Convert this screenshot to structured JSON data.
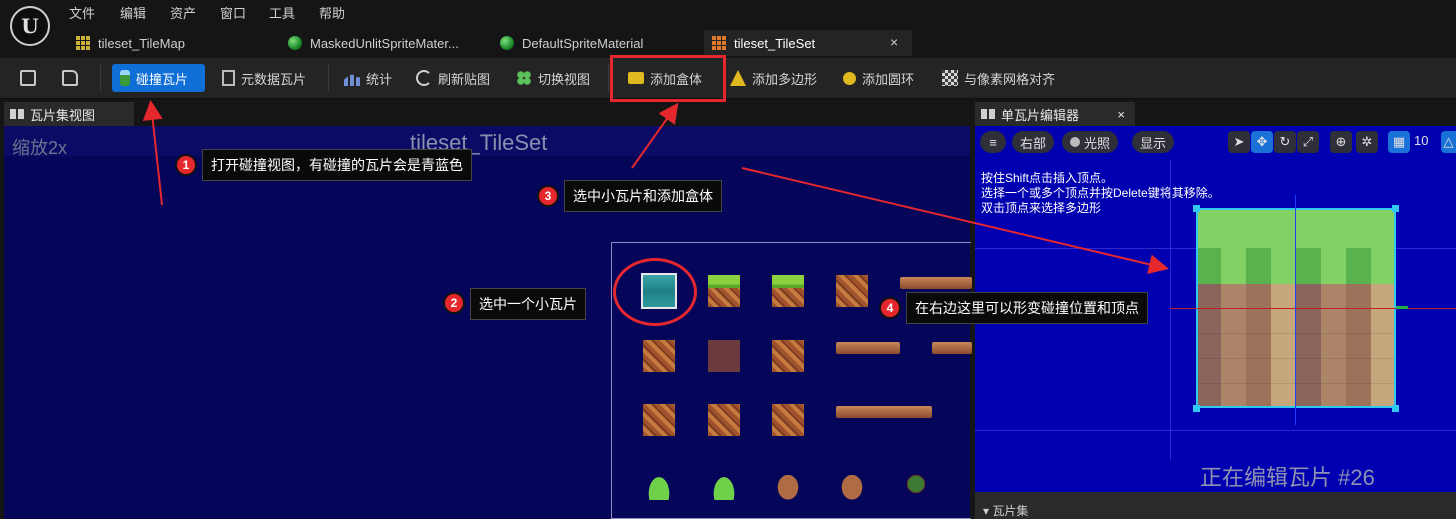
{
  "menu": [
    "文件",
    "编辑",
    "资产",
    "窗口",
    "工具",
    "帮助"
  ],
  "document_tabs": [
    {
      "label": "tileset_TileMap",
      "icon": "tilemap-grid-icon"
    },
    {
      "label": "MaskedUnlitSpriteMater...",
      "icon": "material-sphere-icon"
    },
    {
      "label": "DefaultSpriteMaterial",
      "icon": "material-sphere-icon"
    },
    {
      "label": "tileset_TileSet",
      "icon": "tileset-grid-icon",
      "active": true
    }
  ],
  "tab_close": "×",
  "toolbar": {
    "collision_tiles": "碰撞瓦片",
    "metadata_tiles": "元数据瓦片",
    "stats": "统计",
    "refresh_textures": "刷新贴图",
    "switch_view": "切换视图",
    "add_box": "添加盒体",
    "add_polygon": "添加多边形",
    "add_circle": "添加圆环",
    "snap_to_pixel_grid": "与像素网格对齐"
  },
  "left_panel": {
    "tab": "瓦片集视图",
    "zoom": "缩放2x",
    "title": "tileset_TileSet"
  },
  "right_panel": {
    "tab": "单瓦片编辑器",
    "tab_close": "×",
    "view_mode": "右部",
    "lighting": "光照",
    "show": "显示",
    "grid_size": "10",
    "hints": [
      "按住Shift点击插入顶点。",
      "选择一个或多个顶点并按Delete键将其移除。",
      "双击顶点来选择多边形"
    ],
    "editing_label": "正在编辑瓦片 #26",
    "footer": "瓦片集"
  },
  "annotations": [
    {
      "num": "1",
      "text": "打开碰撞视图，有碰撞的瓦片会是青蓝色"
    },
    {
      "num": "2",
      "text": "选中一个小瓦片"
    },
    {
      "num": "3",
      "text": "选中小瓦片和添加盒体"
    },
    {
      "num": "4",
      "text": "在右边这里可以形变碰撞位置和顶点"
    }
  ],
  "colors": {
    "accent": "#0f6fd6",
    "annotation_red": "#e4282e",
    "viewport_bg": "#05055a",
    "editor_bg": "#0000b0",
    "collision": "#31c8f0"
  }
}
